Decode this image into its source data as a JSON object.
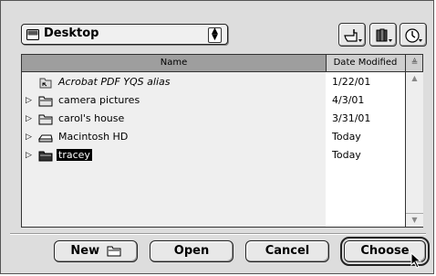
{
  "location": {
    "label": "Desktop"
  },
  "list": {
    "columns": {
      "name": "Name",
      "date": "Date Modified"
    },
    "rows": [
      {
        "name": "Acrobat PDF YQS alias",
        "date": "1/22/01",
        "kind": "alias",
        "expandable": false
      },
      {
        "name": "camera pictures",
        "date": "4/3/01",
        "kind": "folder",
        "expandable": true
      },
      {
        "name": "carol's house",
        "date": "3/31/01",
        "kind": "folder",
        "expandable": true
      },
      {
        "name": "Macintosh HD",
        "date": "Today",
        "kind": "disk",
        "expandable": true
      },
      {
        "name": "tracey",
        "date": "Today",
        "kind": "folder-dark",
        "expandable": true,
        "selected": true
      }
    ]
  },
  "buttons": {
    "new": "New",
    "open": "Open",
    "cancel": "Cancel",
    "choose": "Choose"
  },
  "icons": {
    "toolbar": [
      "pointing-hand-icon",
      "bookmark-books-icon",
      "clock-icon"
    ]
  }
}
